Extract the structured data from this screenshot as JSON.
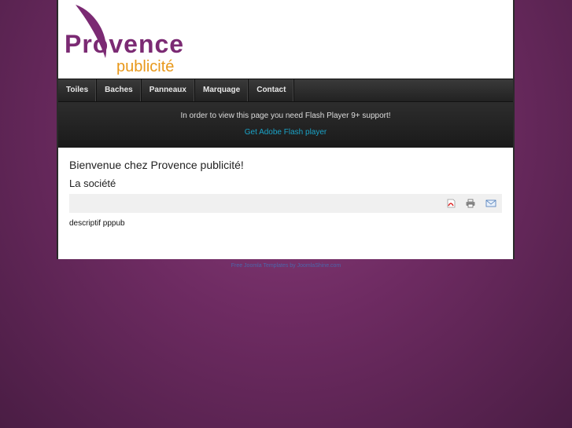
{
  "logo": {
    "line1": "Provence",
    "line2": "publicité"
  },
  "nav": [
    {
      "label": "Toiles"
    },
    {
      "label": "Baches"
    },
    {
      "label": "Panneaux"
    },
    {
      "label": "Marquage"
    },
    {
      "label": "Contact"
    }
  ],
  "flash": {
    "message": "In order to view this page you need Flash Player 9+ support!",
    "link": "Get Adobe Flash player"
  },
  "content": {
    "welcome": "Bienvenue chez Provence publicité!",
    "section_title": "La société",
    "description": "descriptif pppub"
  },
  "toolbar_icons": [
    "pdf-icon",
    "print-icon",
    "email-icon"
  ],
  "footer": {
    "text": "Free Joomla Templates by JoomlaShine.com"
  }
}
